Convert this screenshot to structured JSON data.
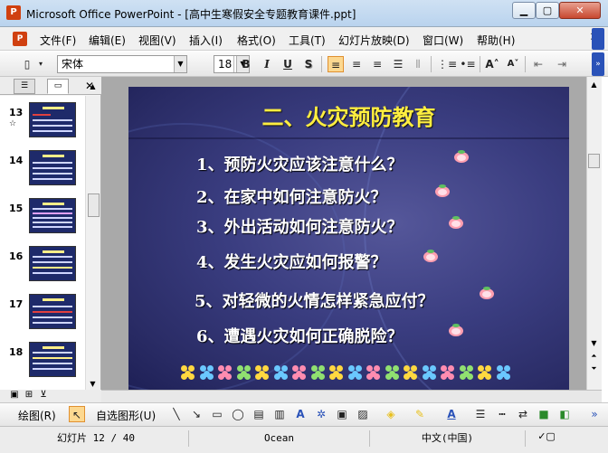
{
  "window": {
    "app_icon_text": "P",
    "title": "Microsoft Office PowerPoint - [高中生寒假安全专题教育课件.ppt]"
  },
  "menu": {
    "items": [
      "文件(F)",
      "编辑(E)",
      "视图(V)",
      "插入(I)",
      "格式(O)",
      "工具(T)",
      "幻灯片放映(D)",
      "窗口(W)",
      "帮助(H)"
    ]
  },
  "toolbar": {
    "font_name": "宋体",
    "font_size": "18",
    "bold": "B",
    "italic": "I",
    "underline": "U",
    "shadow": "S"
  },
  "thumbnails": [
    {
      "number": "13",
      "star": "☆"
    },
    {
      "number": "14"
    },
    {
      "number": "15"
    },
    {
      "number": "16"
    },
    {
      "number": "17"
    },
    {
      "number": "18"
    }
  ],
  "slide": {
    "title": "二、火灾预防教育",
    "questions": [
      "1、预防火灾应该注意什么？",
      "2、在家中如何注意防火？",
      "3、外出活动如何注意防火？",
      "4、发生火灾应如何报警？",
      "5、对轻微的火情怎样紧急应付？",
      "6、遭遇火灾如何正确脱险？"
    ]
  },
  "drawing_toolbar": {
    "draw_label": "绘图(R)",
    "autoshape_label": "自选图形(U)"
  },
  "status": {
    "slide_position": "幻灯片 12 / 40",
    "design": "Ocean",
    "language": "中文(中国)"
  },
  "colors": {
    "slide_title": "#ffee40",
    "slide_text": "#ffffff",
    "slide_bg": "#3a3d80"
  }
}
